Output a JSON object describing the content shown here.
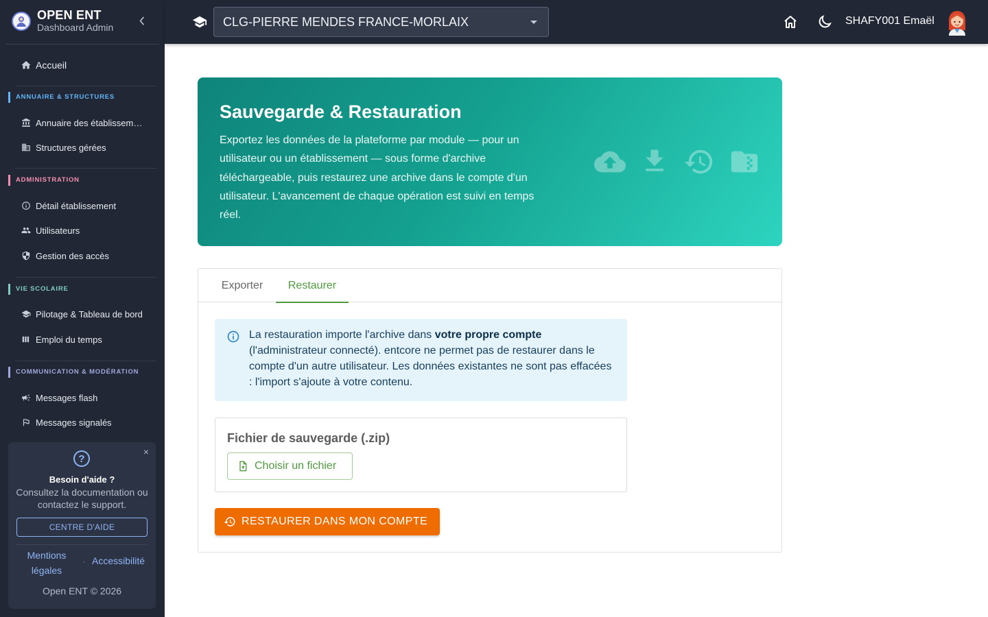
{
  "brand": {
    "title": "OPEN ENT",
    "subtitle": "Dashboard Admin"
  },
  "sidebar": {
    "home": "Accueil",
    "sections": [
      {
        "title": "ANNUAIRE & STRUCTURES",
        "color": "#64b5f6",
        "items": [
          "Annuaire des établissements",
          "Structures gérées"
        ]
      },
      {
        "title": "ADMINISTRATION",
        "color": "#f48fb1",
        "items": [
          "Détail établissement",
          "Utilisateurs",
          "Gestion des accès"
        ]
      },
      {
        "title": "VIE SCOLAIRE",
        "color": "#80cbc4",
        "items": [
          "Pilotage & Tableau de bord",
          "Emploi du temps"
        ]
      },
      {
        "title": "COMMUNICATION & MODÉRATION",
        "color": "#9fa8da",
        "items": [
          "Messages flash",
          "Messages signalés"
        ]
      }
    ],
    "help": {
      "close": "×",
      "icon": "?",
      "title": "Besoin d'aide ?",
      "text": "Consultez la documentation ou contactez le support.",
      "button": "CENTRE D'AIDE",
      "link_legal": "Mentions légales",
      "separator": "·",
      "link_access": "Accessibilité",
      "copyright": "Open ENT © 2026"
    }
  },
  "topbar": {
    "school": "CLG-PIERRE MENDES FRANCE-MORLAIX",
    "user": "SHAFY001 Emaël"
  },
  "hero": {
    "title": "Sauvegarde & Restauration",
    "description": "Exportez les données de la plateforme par module — pour un utilisateur ou un établissement — sous forme d'archive téléchargeable, puis restaurez une archive dans le compte d'un utilisateur. L'avancement de chaque opération est suivi en temps réel.",
    "icons": [
      "cloud-upload-icon",
      "download-icon",
      "history-icon",
      "zip-folder-icon"
    ]
  },
  "tabs": [
    {
      "label": "Exporter",
      "active": false
    },
    {
      "label": "Restaurer",
      "active": true
    }
  ],
  "alert": {
    "text_before": "La restauration importe l'archive dans ",
    "text_bold": "votre propre compte",
    "text_after": " (l'administrateur connecté). entcore ne permet pas de restaurer dans le compte d'un autre utilisateur. Les données existantes ne sont pas effacées : l'import s'ajoute à votre contenu."
  },
  "upload": {
    "title": "Fichier de sauvegarde (.zip)",
    "button": "Choisir un fichier"
  },
  "restore_button": "RESTAURER DANS MON COMPTE",
  "colors": {
    "sidebar_bg": "#212735",
    "accent_green": "#4f9a3c",
    "restore_orange": "#ef6c00",
    "hero_start": "#0f847a",
    "hero_end": "#2dd4bf",
    "link_blue": "#8fb4f5"
  }
}
